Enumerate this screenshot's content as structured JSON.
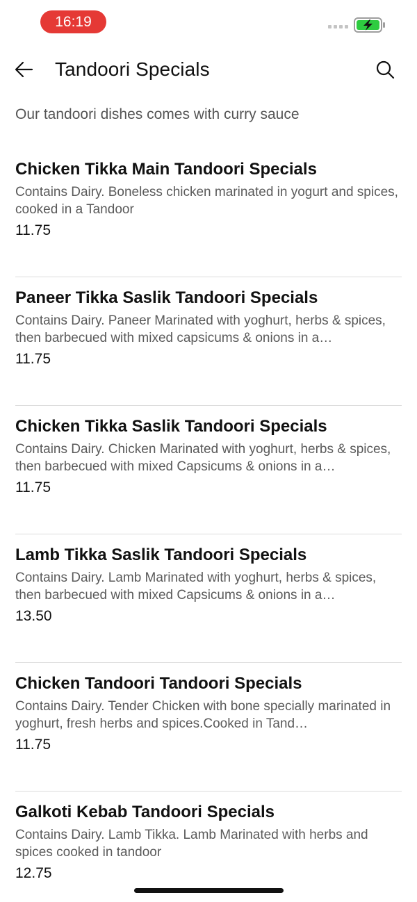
{
  "status_bar": {
    "time": "16:19",
    "battery_color": "#2ecc40",
    "time_pill_color": "#e53935"
  },
  "header": {
    "title": "Tandoori Specials",
    "back_icon": "arrow-left-icon",
    "search_icon": "search-icon"
  },
  "intro_text": "Our tandoori dishes comes with curry sauce",
  "items": [
    {
      "name": "Chicken Tikka Main Tandoori Specials",
      "description": "Contains Dairy. Boneless chicken marinated in yogurt and spices, cooked in a Tandoor",
      "price": "11.75"
    },
    {
      "name": "Paneer Tikka Saslik Tandoori Specials",
      "description": "Contains Dairy. Paneer Marinated with yoghurt, herbs & spices, then barbecued with mixed capsicums  & onions in a…",
      "price": "11.75"
    },
    {
      "name": "Chicken Tikka Saslik Tandoori Specials",
      "description": "Contains Dairy.  Chicken Marinated with yoghurt, herbs & spices, then barbecued with mixed Capsicums & onions in a…",
      "price": "11.75"
    },
    {
      "name": "Lamb Tikka Saslik Tandoori Specials",
      "description": "Contains Dairy.  Lamb Marinated with yoghurt, herbs & spices, then barbecued with mixed Capsicums & onions in a…",
      "price": "13.50"
    },
    {
      "name": "Chicken Tandoori Tandoori Specials",
      "description": "Contains Dairy.  Tender  Chicken with bone specially marinated in yoghurt, fresh herbs and spices.Cooked in Tand…",
      "price": "11.75"
    },
    {
      "name": "Galkoti Kebab Tandoori Specials",
      "description": "Contains Dairy. Lamb Tikka. Lamb Marinated with herbs and spices cooked in tandoor",
      "price": "12.75"
    }
  ]
}
